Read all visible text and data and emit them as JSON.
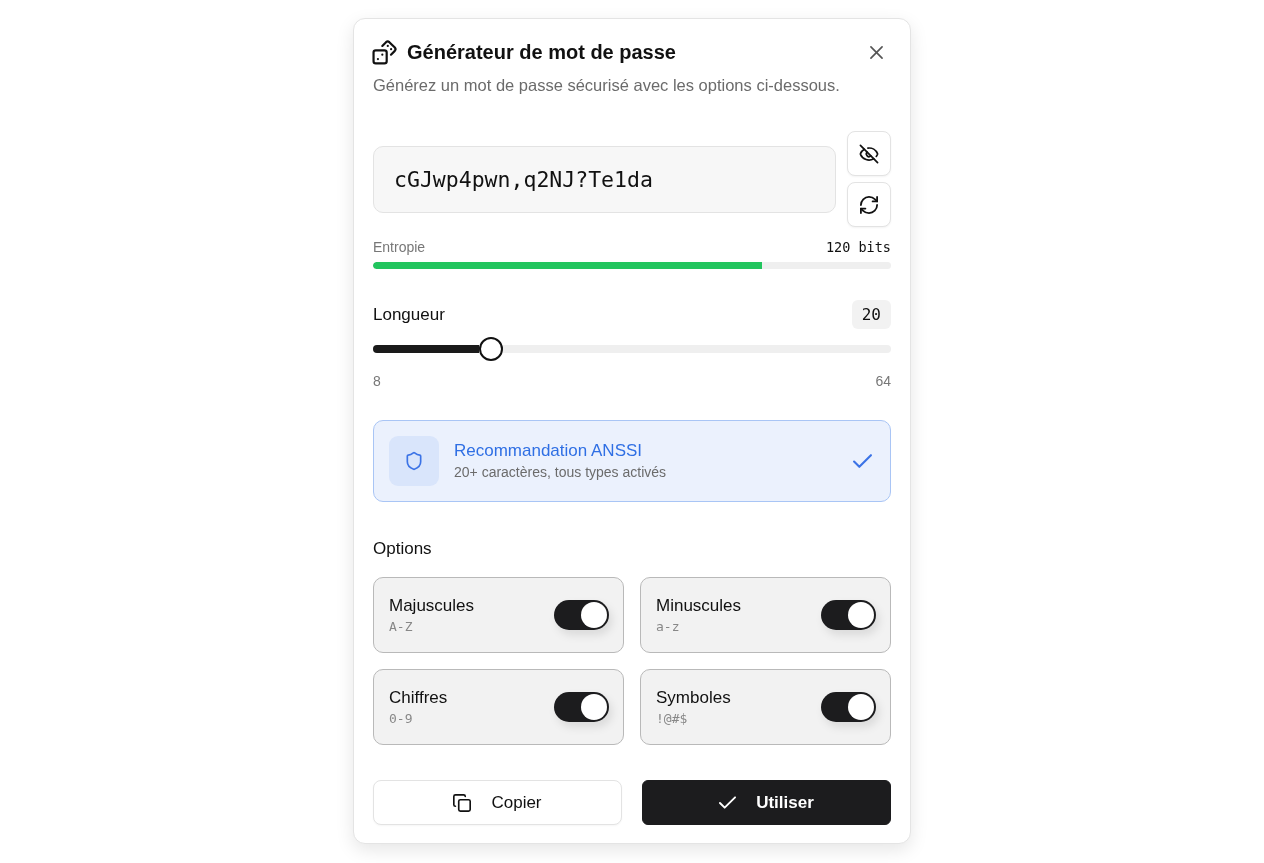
{
  "dialog": {
    "title": "Générateur de mot de passe",
    "subtitle": "Générez un mot de passe sécurisé avec les options ci-dessous."
  },
  "password": {
    "value": "cGJwp4pwn,q2NJ?Te1da"
  },
  "entropy": {
    "label": "Entropie",
    "reading": "120 bits",
    "level": 0.75
  },
  "length": {
    "label": "Longueur",
    "value": "20",
    "level": 0.214,
    "min_label": "8",
    "max_label": "64"
  },
  "recommendation": {
    "title": "Recommandation ANSSI",
    "description": "20+ caractères, tous types activés",
    "met": true
  },
  "options": {
    "heading": "Options",
    "items": [
      {
        "label": "Majuscules",
        "sample": "A-Z",
        "on": true
      },
      {
        "label": "Minuscules",
        "sample": "a-z",
        "on": true
      },
      {
        "label": "Chiffres",
        "sample": "0-9",
        "on": true
      },
      {
        "label": "Symboles",
        "sample": "!@#$",
        "on": true
      }
    ]
  },
  "buttons": [
    {
      "label": "Copier",
      "kind": "secondary"
    },
    {
      "label": "Utiliser",
      "kind": "primary"
    }
  ]
}
